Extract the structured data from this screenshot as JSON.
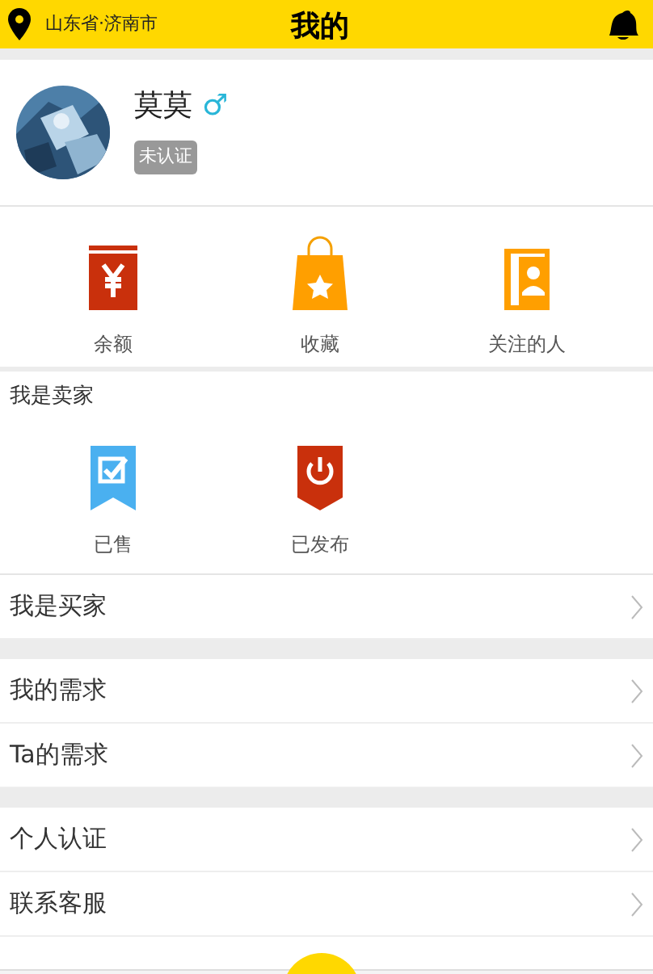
{
  "header": {
    "location": "山东省·济南市",
    "title": "我的"
  },
  "profile": {
    "name": "莫莫",
    "gender": "♂",
    "badge": "未认证"
  },
  "shortcuts": [
    {
      "label": "余额",
      "kind": "wallet"
    },
    {
      "label": "收藏",
      "kind": "bag"
    },
    {
      "label": "关注的人",
      "kind": "contact"
    }
  ],
  "seller": {
    "title": "我是卖家",
    "items": [
      {
        "label": "已售",
        "kind": "sold"
      },
      {
        "label": "已发布",
        "kind": "published"
      }
    ]
  },
  "menu_groups": [
    [
      "我是买家"
    ],
    [
      "我的需求",
      "Ta的需求"
    ],
    [
      "个人认证",
      "联系客服"
    ]
  ]
}
